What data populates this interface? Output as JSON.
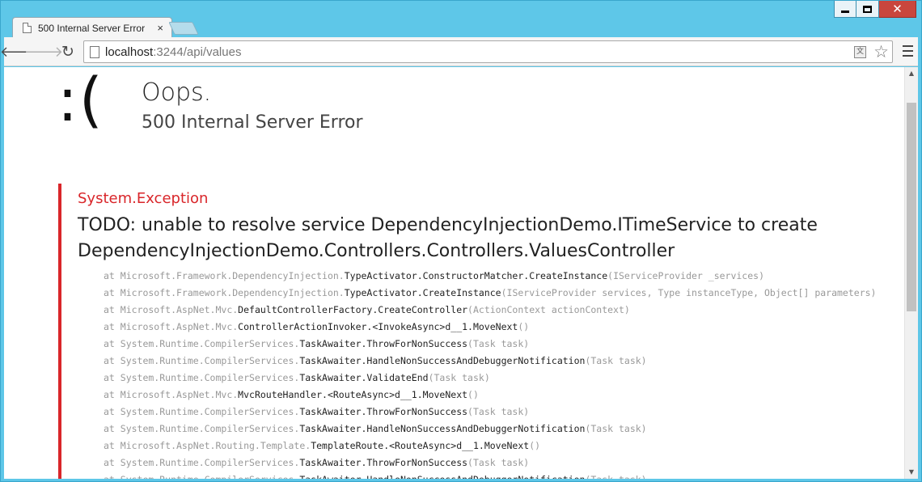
{
  "window": {
    "controls": [
      "minimize",
      "maximize",
      "close"
    ]
  },
  "tabs": [
    {
      "title": "500 Internal Server Error",
      "close_glyph": "×"
    }
  ],
  "toolbar": {
    "url_host": "localhost",
    "url_rest": ":3244/api/values"
  },
  "page": {
    "face": ":(",
    "heading": "Oops.",
    "status": "500 Internal Server Error",
    "exception_type": "System.Exception",
    "exception_message": "TODO: unable to resolve service DependencyInjectionDemo.ITimeService to create DependencyInjectionDemo.Controllers.Controllers.ValuesController",
    "stack": [
      {
        "prefix": "at Microsoft.Framework.DependencyInjection.",
        "method": "TypeActivator.ConstructorMatcher.CreateInstance",
        "args": "(IServiceProvider _services)"
      },
      {
        "prefix": "at Microsoft.Framework.DependencyInjection.",
        "method": "TypeActivator.CreateInstance",
        "args": "(IServiceProvider services, Type instanceType, Object[] parameters)"
      },
      {
        "prefix": "at Microsoft.AspNet.Mvc.",
        "method": "DefaultControllerFactory.CreateController",
        "args": "(ActionContext actionContext)"
      },
      {
        "prefix": "at Microsoft.AspNet.Mvc.",
        "method": "ControllerActionInvoker.<InvokeAsync>d__1.MoveNext",
        "args": "()"
      },
      {
        "prefix": "at System.Runtime.CompilerServices.",
        "method": "TaskAwaiter.ThrowForNonSuccess",
        "args": "(Task task)"
      },
      {
        "prefix": "at System.Runtime.CompilerServices.",
        "method": "TaskAwaiter.HandleNonSuccessAndDebuggerNotification",
        "args": "(Task task)"
      },
      {
        "prefix": "at System.Runtime.CompilerServices.",
        "method": "TaskAwaiter.ValidateEnd",
        "args": "(Task task)"
      },
      {
        "prefix": "at Microsoft.AspNet.Mvc.",
        "method": "MvcRouteHandler.<RouteAsync>d__1.MoveNext",
        "args": "()"
      },
      {
        "prefix": "at System.Runtime.CompilerServices.",
        "method": "TaskAwaiter.ThrowForNonSuccess",
        "args": "(Task task)"
      },
      {
        "prefix": "at System.Runtime.CompilerServices.",
        "method": "TaskAwaiter.HandleNonSuccessAndDebuggerNotification",
        "args": "(Task task)"
      },
      {
        "prefix": "at Microsoft.AspNet.Routing.Template.",
        "method": "TemplateRoute.<RouteAsync>d__1.MoveNext",
        "args": "()"
      },
      {
        "prefix": "at System.Runtime.CompilerServices.",
        "method": "TaskAwaiter.ThrowForNonSuccess",
        "args": "(Task task)"
      },
      {
        "prefix": "at System.Runtime.CompilerServices.",
        "method": "TaskAwaiter.HandleNonSuccessAndDebuggerNotification",
        "args": "(Task task)"
      }
    ]
  },
  "colors": {
    "window_frame": "#5ec7e8",
    "accent_red": "#d9262a",
    "close_button": "#c9463d"
  }
}
